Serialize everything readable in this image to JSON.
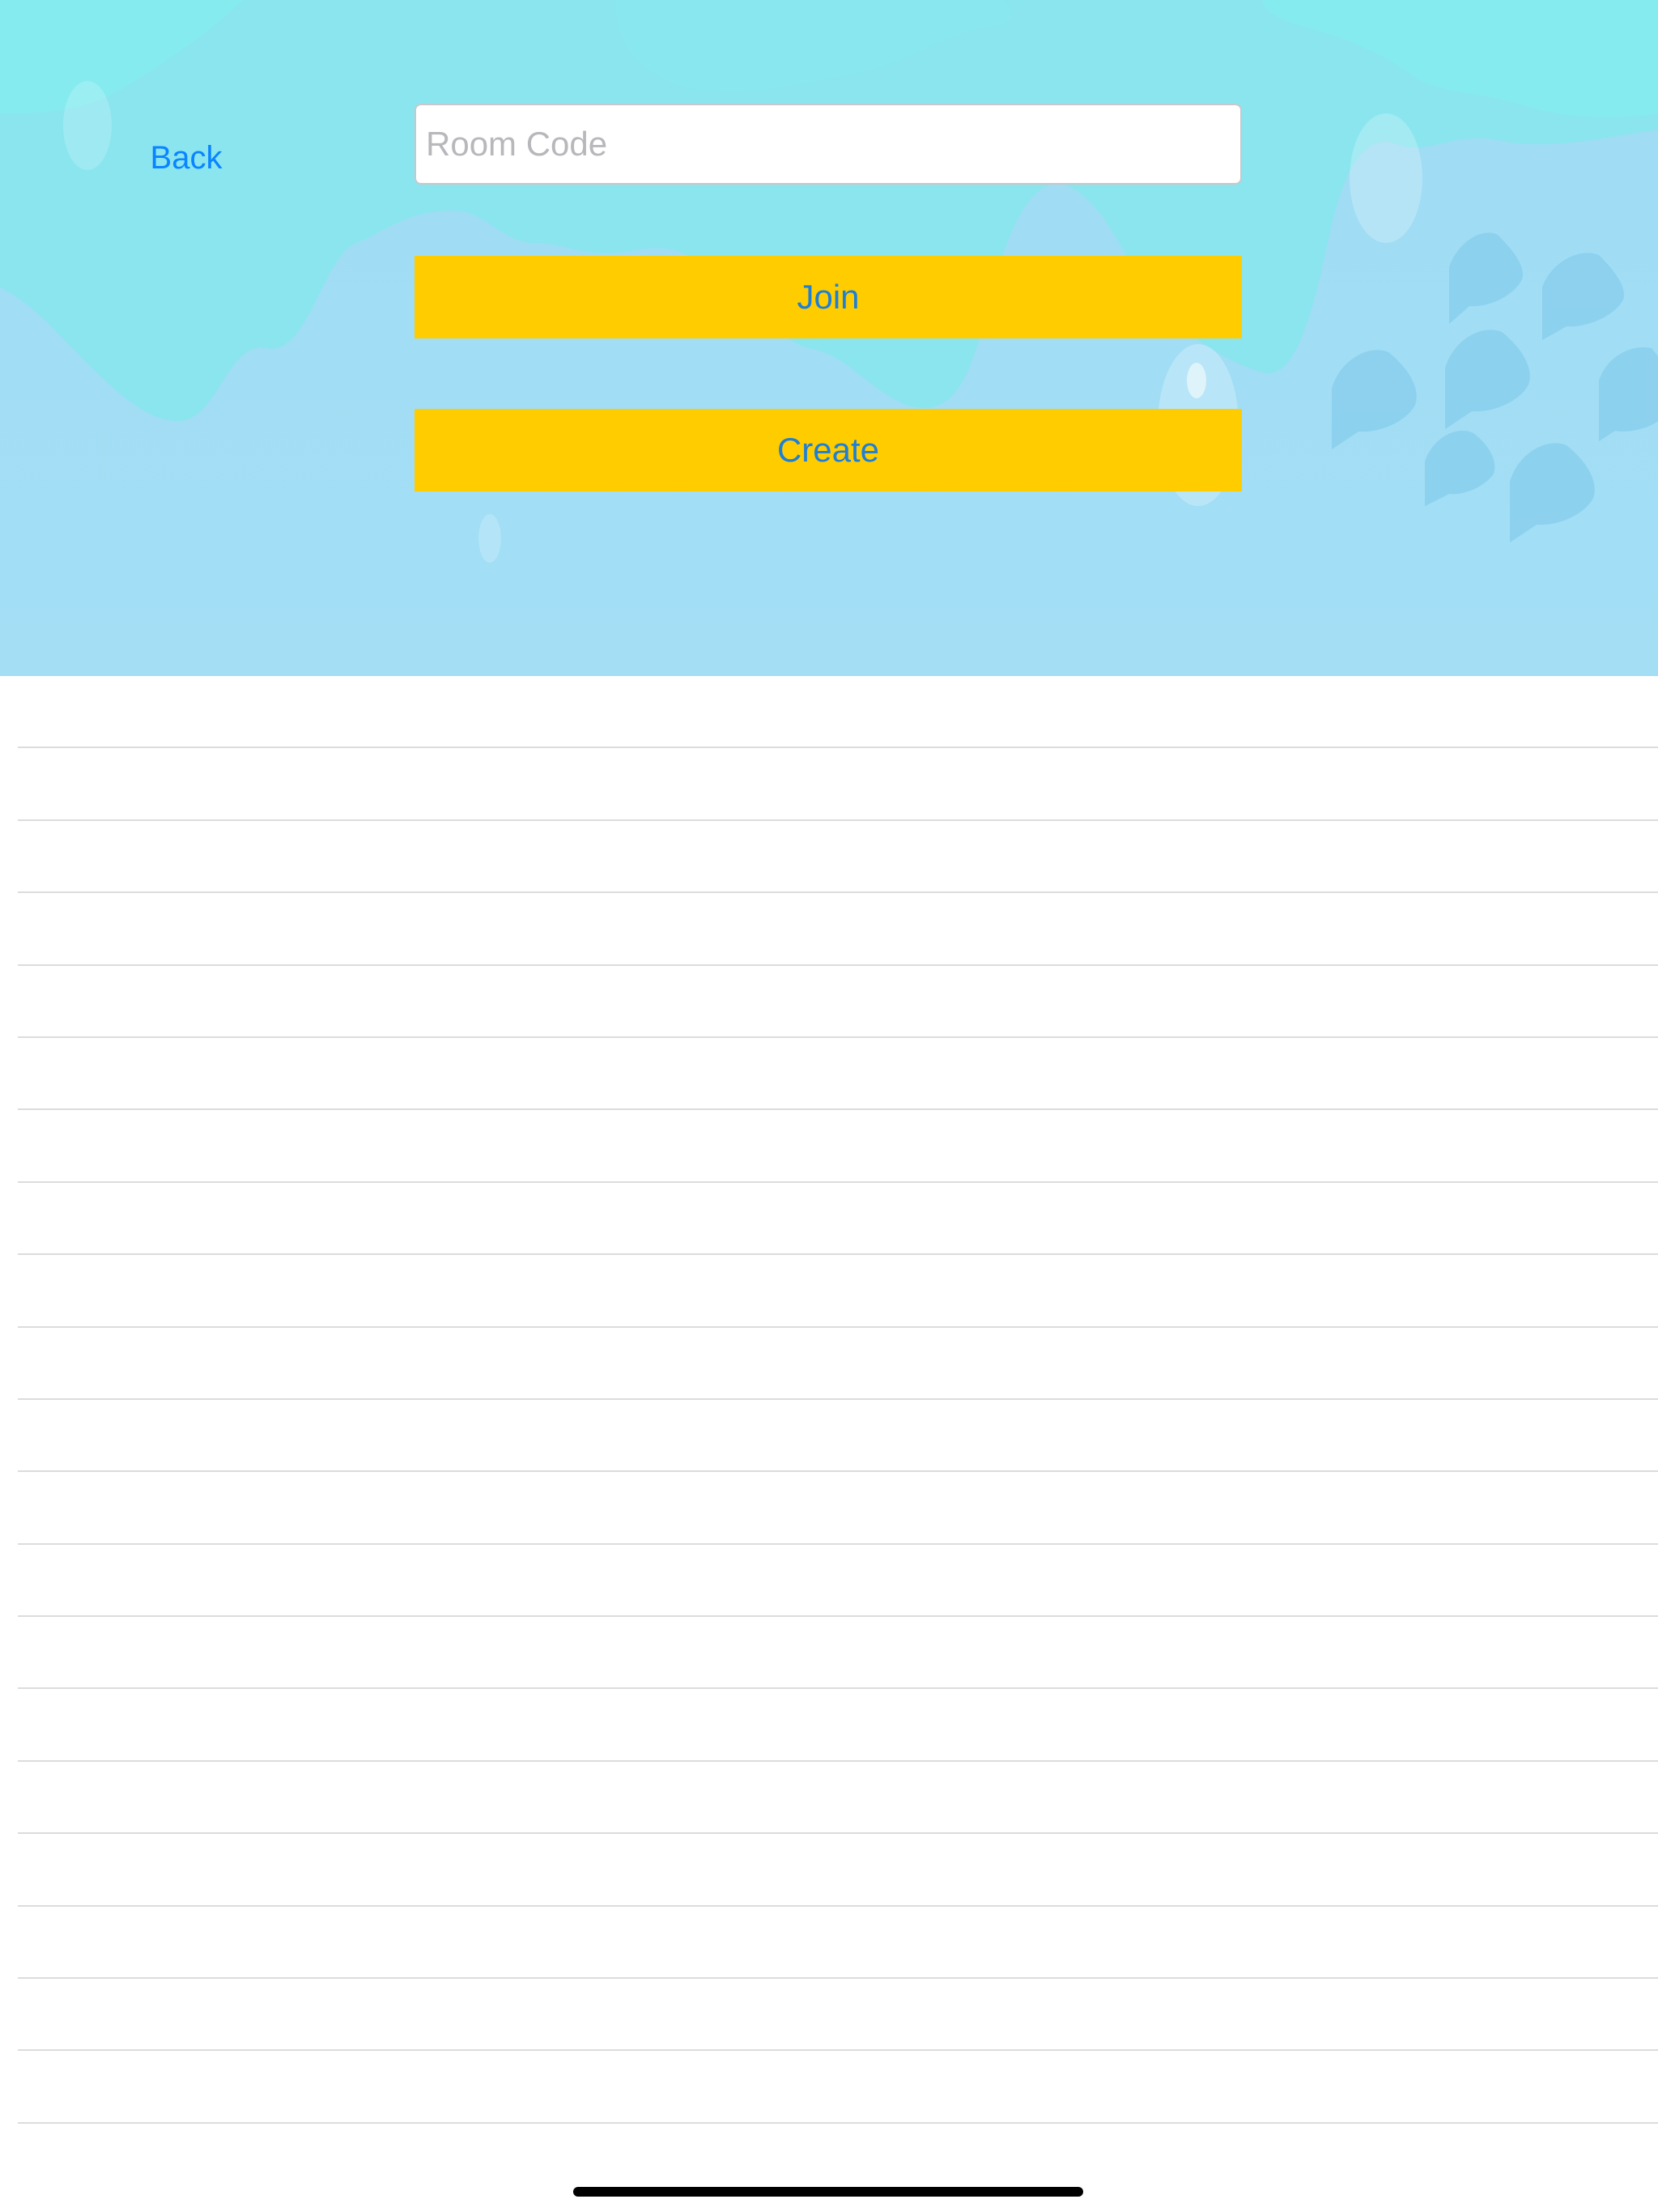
{
  "nav": {
    "back_label": "Back"
  },
  "room_form": {
    "room_code_placeholder": "Room Code",
    "room_code_value": "",
    "join_label": "Join",
    "create_label": "Create"
  },
  "colors": {
    "link_blue": "#0a84ff",
    "button_yellow": "#ffcc00",
    "button_text": "#1d7fd6",
    "water_light": "#8aeaee",
    "water": "#a2ddf4"
  }
}
